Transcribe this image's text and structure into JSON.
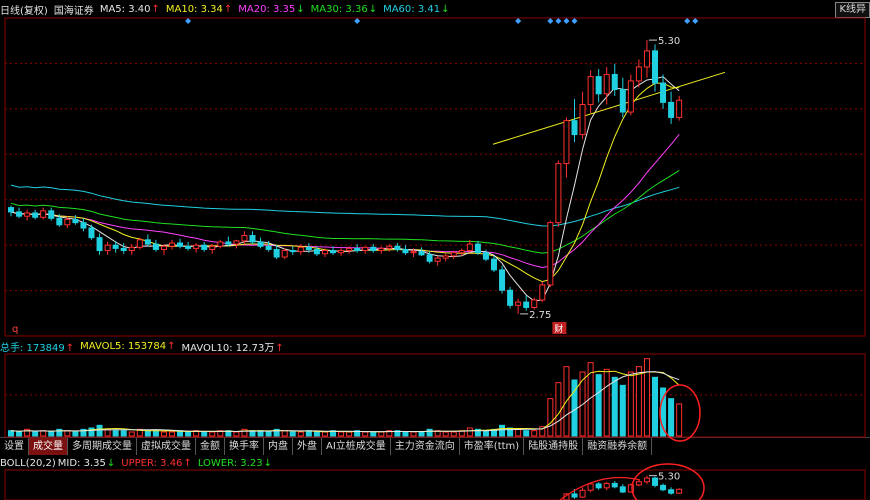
{
  "header": {
    "period": "日线(复权)",
    "stock": "国海证券",
    "ma": [
      {
        "label": "MA5: 3.40",
        "cls": "w",
        "dir": "up"
      },
      {
        "label": "MA10: 3.34",
        "cls": "y",
        "dir": "up"
      },
      {
        "label": "MA20: 3.35",
        "cls": "m",
        "dir": "dn"
      },
      {
        "label": "MA30: 3.36",
        "cls": "g",
        "dir": "dn"
      },
      {
        "label": "MA60: 3.41",
        "cls": "c",
        "dir": "dn"
      }
    ],
    "badge": "K线异"
  },
  "volume_header": {
    "total": "总手: 173849",
    "mavol5": "MAVOL5: 153784",
    "mavol10": "MAVOL10: 12.73万"
  },
  "boll_header": {
    "name": "BOLL(20,2)",
    "mid": "MID: 3.35",
    "upper": "UPPER: 3.46",
    "lower": "LOWER: 3.23"
  },
  "tabs": [
    "设置",
    "成交量",
    "多周期成交量",
    "虚拟成交量",
    "金额",
    "换手率",
    "内盘",
    "外盘",
    "AI立桩成交量",
    "主力资金流向",
    "市盈率(ttm)",
    "陆股通持股",
    "融资融券余额"
  ],
  "active_tab": 1,
  "markers": {
    "q": "q",
    "caibao": "财"
  },
  "colors": {
    "up": "#ff3030",
    "down": "#20d0e0",
    "ma5": "#e6e6e6",
    "ma10": "#f0f020",
    "ma20": "#ff40ff",
    "ma30": "#20e020",
    "ma60": "#20d0e0",
    "trend": "#f0f020",
    "grid": "#8b0000",
    "circle": "#ff2020"
  },
  "chart_data": {
    "type": "candlestick",
    "ylim": [
      2.6,
      5.45
    ],
    "high_label": "5.30",
    "low_label": "2.75",
    "candles": [
      [
        3.74,
        3.76,
        3.66,
        3.7
      ],
      [
        3.7,
        3.74,
        3.64,
        3.66
      ],
      [
        3.66,
        3.72,
        3.62,
        3.69
      ],
      [
        3.69,
        3.72,
        3.63,
        3.65
      ],
      [
        3.65,
        3.74,
        3.63,
        3.71
      ],
      [
        3.71,
        3.74,
        3.62,
        3.64
      ],
      [
        3.64,
        3.68,
        3.56,
        3.58
      ],
      [
        3.58,
        3.66,
        3.55,
        3.63
      ],
      [
        3.63,
        3.67,
        3.58,
        3.6
      ],
      [
        3.6,
        3.64,
        3.52,
        3.55
      ],
      [
        3.55,
        3.58,
        3.44,
        3.46
      ],
      [
        3.46,
        3.5,
        3.3,
        3.34
      ],
      [
        3.34,
        3.42,
        3.3,
        3.39
      ],
      [
        3.39,
        3.43,
        3.32,
        3.36
      ],
      [
        3.36,
        3.41,
        3.31,
        3.34
      ],
      [
        3.34,
        3.4,
        3.3,
        3.37
      ],
      [
        3.37,
        3.46,
        3.35,
        3.44
      ],
      [
        3.44,
        3.49,
        3.38,
        3.4
      ],
      [
        3.4,
        3.44,
        3.33,
        3.35
      ],
      [
        3.35,
        3.4,
        3.3,
        3.38
      ],
      [
        3.38,
        3.44,
        3.35,
        3.41
      ],
      [
        3.41,
        3.45,
        3.36,
        3.38
      ],
      [
        3.38,
        3.42,
        3.34,
        3.36
      ],
      [
        3.36,
        3.41,
        3.32,
        3.39
      ],
      [
        3.39,
        3.42,
        3.33,
        3.35
      ],
      [
        3.35,
        3.4,
        3.31,
        3.38
      ],
      [
        3.38,
        3.44,
        3.36,
        3.42
      ],
      [
        3.42,
        3.47,
        3.38,
        3.4
      ],
      [
        3.4,
        3.44,
        3.36,
        3.43
      ],
      [
        3.43,
        3.52,
        3.4,
        3.48
      ],
      [
        3.48,
        3.52,
        3.4,
        3.42
      ],
      [
        3.42,
        3.46,
        3.36,
        3.38
      ],
      [
        3.38,
        3.43,
        3.33,
        3.35
      ],
      [
        3.35,
        3.39,
        3.26,
        3.28
      ],
      [
        3.28,
        3.36,
        3.26,
        3.34
      ],
      [
        3.34,
        3.38,
        3.3,
        3.33
      ],
      [
        3.33,
        3.4,
        3.3,
        3.37
      ],
      [
        3.37,
        3.41,
        3.32,
        3.35
      ],
      [
        3.35,
        3.38,
        3.29,
        3.31
      ],
      [
        3.31,
        3.36,
        3.28,
        3.34
      ],
      [
        3.34,
        3.38,
        3.3,
        3.32
      ],
      [
        3.32,
        3.36,
        3.29,
        3.34
      ],
      [
        3.34,
        3.38,
        3.31,
        3.36
      ],
      [
        3.36,
        3.4,
        3.32,
        3.34
      ],
      [
        3.34,
        3.38,
        3.31,
        3.37
      ],
      [
        3.37,
        3.4,
        3.32,
        3.34
      ],
      [
        3.34,
        3.38,
        3.31,
        3.36
      ],
      [
        3.36,
        3.4,
        3.33,
        3.38
      ],
      [
        3.38,
        3.41,
        3.33,
        3.35
      ],
      [
        3.35,
        3.39,
        3.3,
        3.32
      ],
      [
        3.32,
        3.36,
        3.28,
        3.33
      ],
      [
        3.33,
        3.37,
        3.29,
        3.3
      ],
      [
        3.3,
        3.33,
        3.22,
        3.24
      ],
      [
        3.24,
        3.29,
        3.2,
        3.27
      ],
      [
        3.27,
        3.31,
        3.24,
        3.29
      ],
      [
        3.29,
        3.34,
        3.26,
        3.32
      ],
      [
        3.32,
        3.36,
        3.29,
        3.34
      ],
      [
        3.34,
        3.44,
        3.32,
        3.4
      ],
      [
        3.4,
        3.43,
        3.3,
        3.32
      ],
      [
        3.32,
        3.35,
        3.24,
        3.26
      ],
      [
        3.26,
        3.29,
        3.14,
        3.16
      ],
      [
        3.16,
        3.2,
        2.94,
        2.97
      ],
      [
        2.97,
        3.0,
        2.8,
        2.83
      ],
      [
        2.83,
        2.89,
        2.75,
        2.86
      ],
      [
        2.86,
        2.92,
        2.78,
        2.81
      ],
      [
        2.81,
        2.9,
        2.79,
        2.88
      ],
      [
        2.88,
        3.05,
        2.86,
        3.02
      ],
      [
        3.02,
        3.62,
        3.0,
        3.6
      ],
      [
        3.6,
        4.18,
        3.56,
        4.15
      ],
      [
        4.15,
        4.58,
        4.02,
        4.55
      ],
      [
        4.55,
        4.75,
        4.35,
        4.42
      ],
      [
        4.42,
        4.82,
        4.38,
        4.7
      ],
      [
        4.7,
        5.02,
        4.62,
        4.96
      ],
      [
        4.96,
        5.03,
        4.72,
        4.8
      ],
      [
        4.8,
        5.05,
        4.7,
        4.98
      ],
      [
        4.98,
        5.08,
        4.78,
        4.84
      ],
      [
        4.84,
        4.95,
        4.58,
        4.63
      ],
      [
        4.63,
        4.98,
        4.6,
        4.92
      ],
      [
        4.92,
        5.12,
        4.86,
        5.05
      ],
      [
        5.05,
        5.3,
        4.95,
        5.2
      ],
      [
        5.2,
        5.26,
        4.82,
        4.9
      ],
      [
        4.9,
        4.98,
        4.66,
        4.72
      ],
      [
        4.72,
        4.82,
        4.52,
        4.58
      ],
      [
        4.58,
        4.78,
        4.55,
        4.74
      ]
    ],
    "volume": [
      4,
      3,
      5,
      3,
      4,
      3,
      5,
      4,
      3,
      5,
      6,
      8,
      5,
      4,
      4,
      3,
      5,
      4,
      4,
      3,
      3,
      4,
      3,
      4,
      3,
      3,
      4,
      4,
      3,
      5,
      4,
      4,
      3,
      5,
      4,
      3,
      3,
      4,
      3,
      3,
      4,
      3,
      3,
      4,
      3,
      3,
      3,
      4,
      4,
      3,
      3,
      3,
      5,
      4,
      3,
      3,
      4,
      6,
      5,
      4,
      5,
      8,
      6,
      5,
      4,
      4,
      7,
      28,
      40,
      52,
      42,
      48,
      55,
      46,
      50,
      44,
      38,
      48,
      52,
      58,
      44,
      36,
      28,
      24
    ],
    "trend_line": [
      [
        3.6,
        4.95
      ]
    ]
  }
}
